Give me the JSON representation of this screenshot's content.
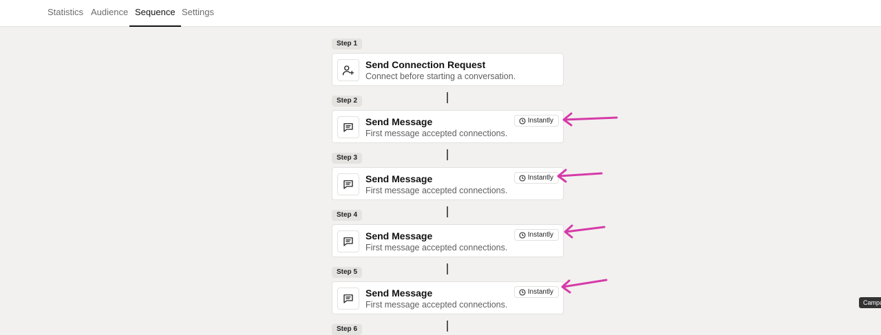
{
  "nav": {
    "tabs": [
      {
        "label": "Statistics"
      },
      {
        "label": "Audience"
      },
      {
        "label": "Sequence"
      },
      {
        "label": "Settings"
      }
    ],
    "active_tab": "Sequence"
  },
  "steps": [
    {
      "badge": "Step 1",
      "icon": "user-plus-icon",
      "title": "Send Connection Request",
      "subtitle": "Connect before starting a conversation."
    },
    {
      "badge": "Step 2",
      "icon": "message-icon",
      "title": "Send Message",
      "subtitle": "First message accepted connections.",
      "timing": "Instantly"
    },
    {
      "badge": "Step 3",
      "icon": "message-icon",
      "title": "Send Message",
      "subtitle": "First message accepted connections.",
      "timing": "Instantly"
    },
    {
      "badge": "Step 4",
      "icon": "message-icon",
      "title": "Send Message",
      "subtitle": "First message accepted connections.",
      "timing": "Instantly"
    },
    {
      "badge": "Step 5",
      "icon": "message-icon",
      "title": "Send Message",
      "subtitle": "First message accepted connections.",
      "timing": "Instantly"
    },
    {
      "badge": "Step 6"
    }
  ],
  "side_tag": "Campa",
  "colors": {
    "annotation_arrow": "#d63aa8",
    "background": "#f2f1ef"
  }
}
